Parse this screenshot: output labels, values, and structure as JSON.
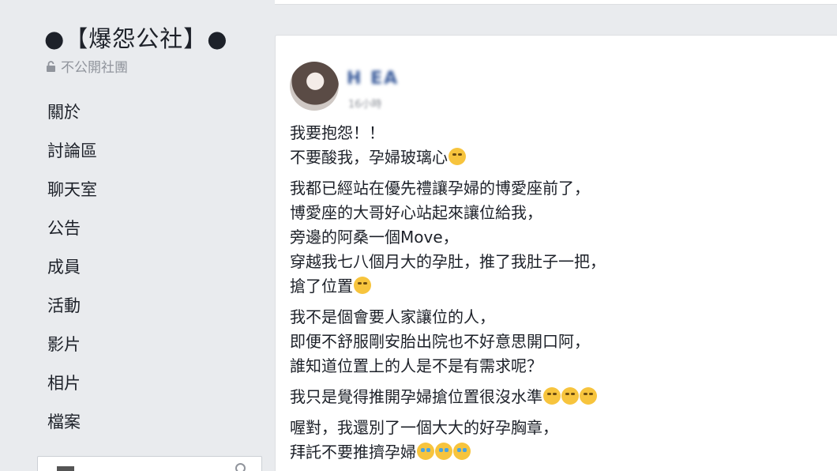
{
  "sidebar": {
    "group_name": "●【爆怨公社】●",
    "privacy": "不公開社團",
    "items": [
      {
        "label": "關於"
      },
      {
        "label": "討論區"
      },
      {
        "label": "聊天室"
      },
      {
        "label": "公告"
      },
      {
        "label": "成員"
      },
      {
        "label": "活動"
      },
      {
        "label": "影片"
      },
      {
        "label": "相片"
      },
      {
        "label": "檔案"
      }
    ]
  },
  "post": {
    "author": "H EA",
    "time": "16小時",
    "lines": [
      "我要抱怨！！",
      "不要酸我，孕婦玻璃心",
      "我都已經站在優先禮讓孕婦的博愛座前了，",
      "博愛座的大哥好心站起來讓位給我，",
      "旁邊的阿桑一個Move，",
      "穿越我七八個月大的孕肚，推了我肚子一把，",
      "搶了位置",
      "我不是個會要人家讓位的人，",
      "即便不舒服剛安胎出院也不好意思開口阿，",
      "誰知道位置上的人是不是有需求呢？",
      "我只是覺得推開孕婦搶位置很沒水準",
      "喔對，我還別了一個大大的好孕胸章，",
      "拜託不要推擠孕婦"
    ],
    "emoji": {
      "laugh": "grinning-sweat-emoji",
      "rolleyes": "rolling-eyes-emoji",
      "cry": "crying-emoji"
    }
  }
}
